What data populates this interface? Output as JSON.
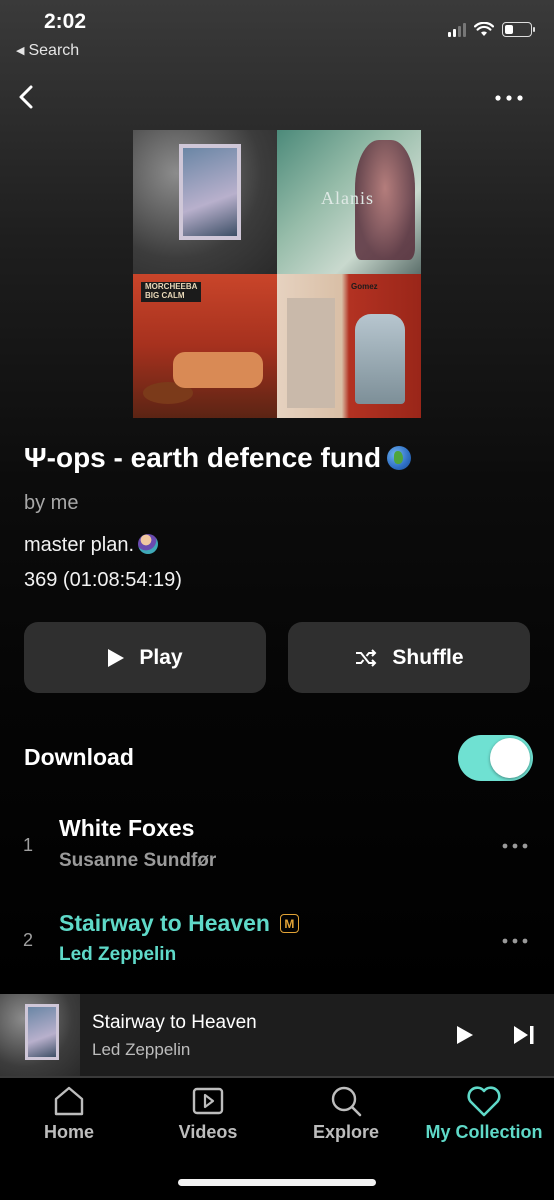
{
  "status_bar": {
    "time": "2:02",
    "back_label": "Search"
  },
  "playlist": {
    "title": "Ψ-ops - earth defence fund",
    "owner": "by me",
    "description": "master plan.",
    "stats": "369 (01:08:54:19)",
    "cover_texts": [
      "Alanis",
      "MORCHEEBA",
      "BIG CALM",
      "Gomez"
    ]
  },
  "actions": {
    "play": "Play",
    "shuffle": "Shuffle"
  },
  "download": {
    "label": "Download",
    "enabled": true
  },
  "tracks": [
    {
      "number": "1",
      "title": "White Foxes",
      "artist": "Susanne Sundfør",
      "playing": false,
      "badge": ""
    },
    {
      "number": "2",
      "title": "Stairway to Heaven",
      "artist": "Led Zeppelin",
      "playing": true,
      "badge": "M"
    }
  ],
  "now_playing": {
    "title": "Stairway to Heaven",
    "artist": "Led Zeppelin"
  },
  "tabs": [
    {
      "label": "Home",
      "icon": "home-icon",
      "active": false
    },
    {
      "label": "Videos",
      "icon": "video-icon",
      "active": false
    },
    {
      "label": "Explore",
      "icon": "search-icon",
      "active": false
    },
    {
      "label": "My Collection",
      "icon": "heart-icon",
      "active": true
    }
  ],
  "colors": {
    "accent": "#5fd9c8",
    "toggle_on": "#6fe1d2",
    "badge": "#e2a336",
    "button_bg": "#2f2f2f"
  }
}
